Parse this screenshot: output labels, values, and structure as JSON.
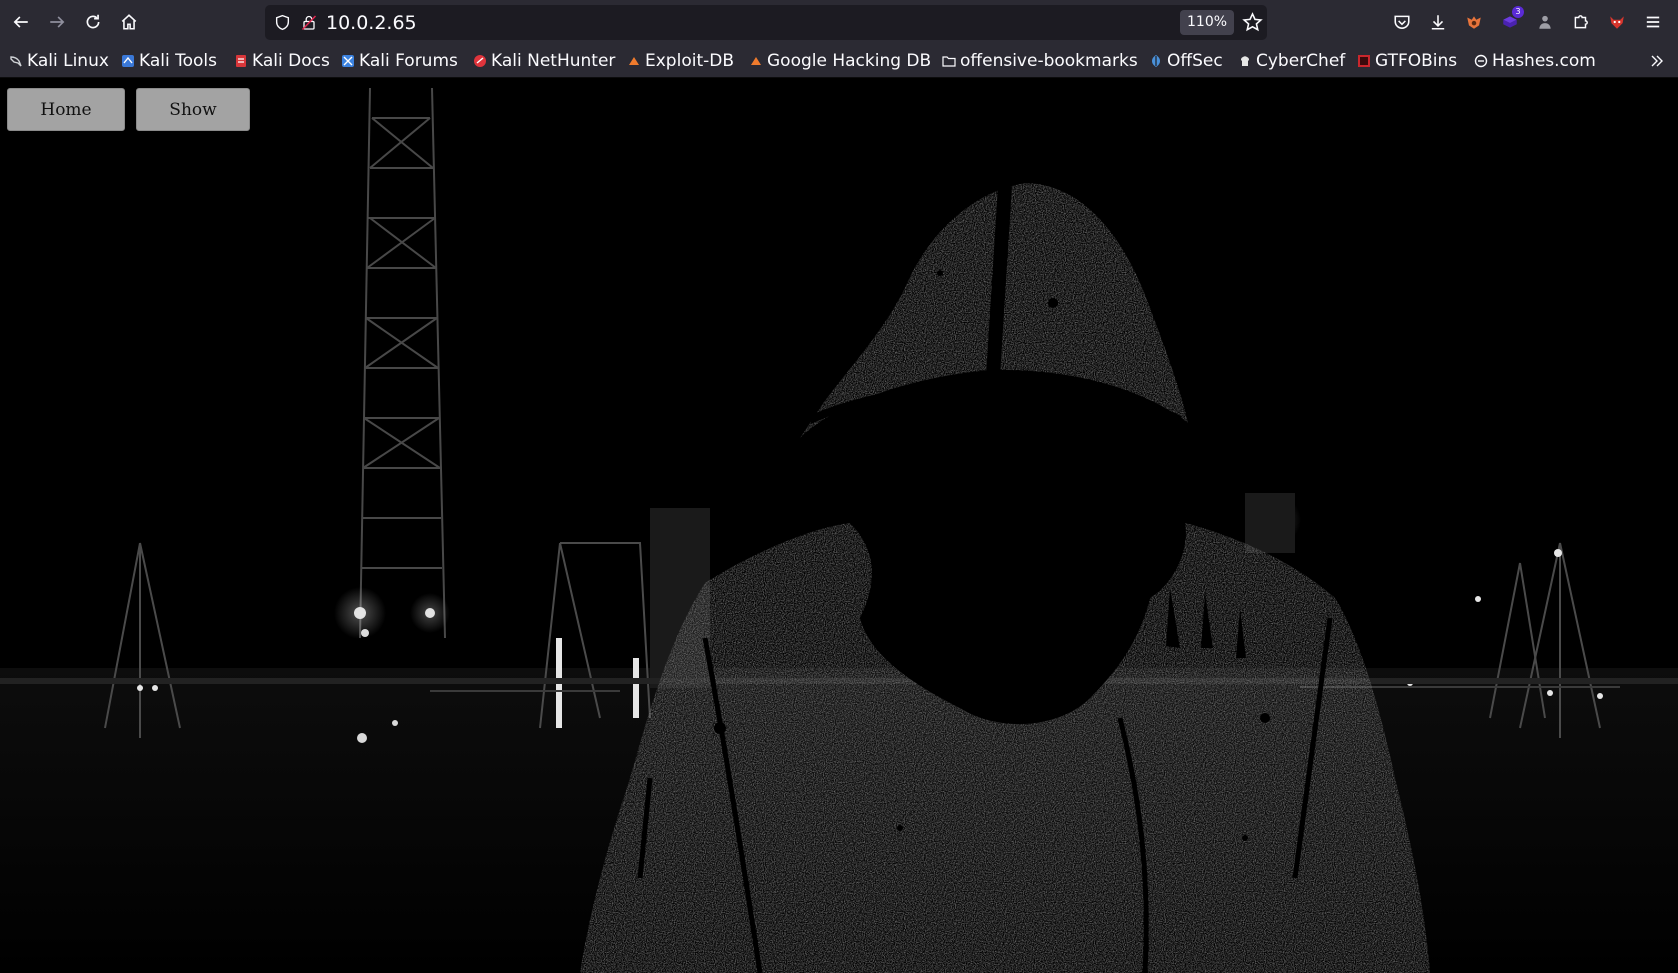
{
  "browser": {
    "url": "10.0.2.65",
    "zoom": "110%"
  },
  "bookmarks": [
    {
      "label": "Kali Linux",
      "icon": "kali-dragon-icon",
      "color": "#cfd2d6"
    },
    {
      "label": "Kali Tools",
      "icon": "kali-tools-icon",
      "color": "#3a78d8"
    },
    {
      "label": "Kali Docs",
      "icon": "kali-docs-icon",
      "color": "#d8363a"
    },
    {
      "label": "Kali Forums",
      "icon": "kali-forums-icon",
      "color": "#3b82e0"
    },
    {
      "label": "Kali NetHunter",
      "icon": "nethunter-icon",
      "color": "#e0343c"
    },
    {
      "label": "Exploit-DB",
      "icon": "exploit-db-icon",
      "color": "#f07b2d"
    },
    {
      "label": "Google Hacking DB",
      "icon": "ghdb-icon",
      "color": "#f07b2d"
    },
    {
      "label": "offensive-bookmarks",
      "icon": "folder-icon",
      "color": "#fbfbfe"
    },
    {
      "label": "OffSec",
      "icon": "offsec-icon",
      "color": "#4a90d9"
    },
    {
      "label": "CyberChef",
      "icon": "cyberchef-icon",
      "color": "#e6e6e6"
    },
    {
      "label": "GTFOBins",
      "icon": "gtfobins-icon",
      "color": "#c9262c"
    },
    {
      "label": "Hashes.com",
      "icon": "hashes-icon",
      "color": "#fbfbfe"
    }
  ],
  "page": {
    "nav": {
      "home_label": "Home",
      "show_label": "Show"
    }
  }
}
